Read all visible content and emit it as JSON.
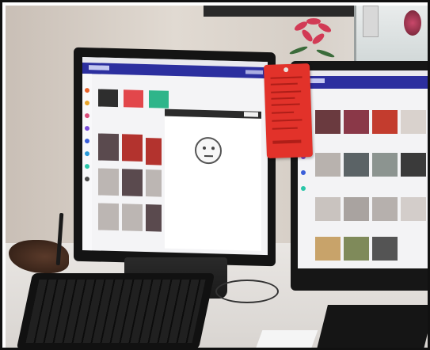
{
  "photo": {
    "colors": {
      "app_header": "#2c2f9f",
      "tag": "#e2322a",
      "flower": "#d23a55",
      "frame": "#111111"
    }
  }
}
